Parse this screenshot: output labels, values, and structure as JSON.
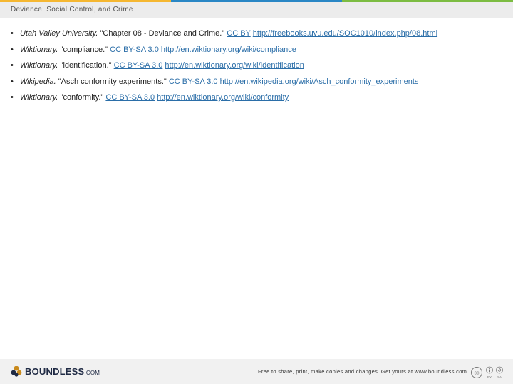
{
  "top_bar_colors": [
    "#f5b731",
    "#2a87c5",
    "#7cbc42"
  ],
  "header": {
    "title": "Deviance, Social Control, and Crime"
  },
  "references": [
    {
      "bullet": "•",
      "source": "Utah Valley University.",
      "title": " \"Chapter 08 - Deviance and Crime.\" ",
      "license": "CC BY",
      "url": "http://freebooks.uvu.edu/SOC1010/index.php/08.html"
    },
    {
      "bullet": "•",
      "source": "Wiktionary.",
      "title": " \"compliance.\" ",
      "license": "CC BY-SA 3.0",
      "url": "http://en.wiktionary.org/wiki/compliance"
    },
    {
      "bullet": "•",
      "source": "Wiktionary.",
      "title": " \"identification.\" ",
      "license": "CC BY-SA 3.0",
      "url": "http://en.wiktionary.org/wiki/identification"
    },
    {
      "bullet": "•",
      "source": "Wikipedia.",
      "title": " \"Asch conformity experiments.\" ",
      "license": "CC BY-SA 3.0",
      "url": "http://en.wikipedia.org/wiki/Asch_conformity_experiments"
    },
    {
      "bullet": "•",
      "source": "Wiktionary.",
      "title": " \"conformity.\" ",
      "license": "CC BY-SA 3.0",
      "url": "http://en.wiktionary.org/wiki/conformity"
    }
  ],
  "footer": {
    "logo_text": "BOUNDLESS",
    "logo_suffix": ".COM",
    "tagline": "Free to share, print, make copies and changes. Get yours at www.boundless.com",
    "cc_labels": [
      "cc",
      "BY",
      "SA"
    ]
  }
}
